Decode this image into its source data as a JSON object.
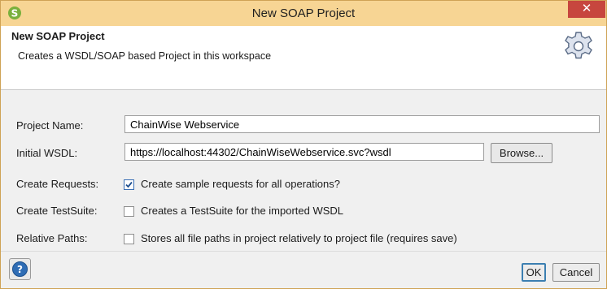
{
  "window": {
    "title": "New SOAP Project",
    "close_glyph": "✕",
    "app_icon": "soapui-s-logo-icon"
  },
  "header": {
    "title": "New SOAP Project",
    "description": "Creates a WSDL/SOAP based Project in this workspace",
    "icon": "gear-icon"
  },
  "form": {
    "project_name": {
      "label": "Project Name:",
      "value": "ChainWise Webservice"
    },
    "initial_wsdl": {
      "label": "Initial WSDL:",
      "value": "https://localhost:44302/ChainWiseWebservice.svc?wsdl",
      "browse_label": "Browse..."
    },
    "create_requests": {
      "label": "Create Requests:",
      "checked": true,
      "text": "Create sample requests for all operations?"
    },
    "create_testsuite": {
      "label": "Create TestSuite:",
      "checked": false,
      "text": "Creates a TestSuite for the imported WSDL"
    },
    "relative_paths": {
      "label": "Relative Paths:",
      "checked": false,
      "text": "Stores all file paths in project relatively to project file (requires save)"
    }
  },
  "footer": {
    "help_icon": "help-icon",
    "ok_label": "OK",
    "cancel_label": "Cancel"
  },
  "colors": {
    "titlebar": "#f7d594",
    "close": "#c7463e",
    "accent": "#3c7fb1"
  }
}
